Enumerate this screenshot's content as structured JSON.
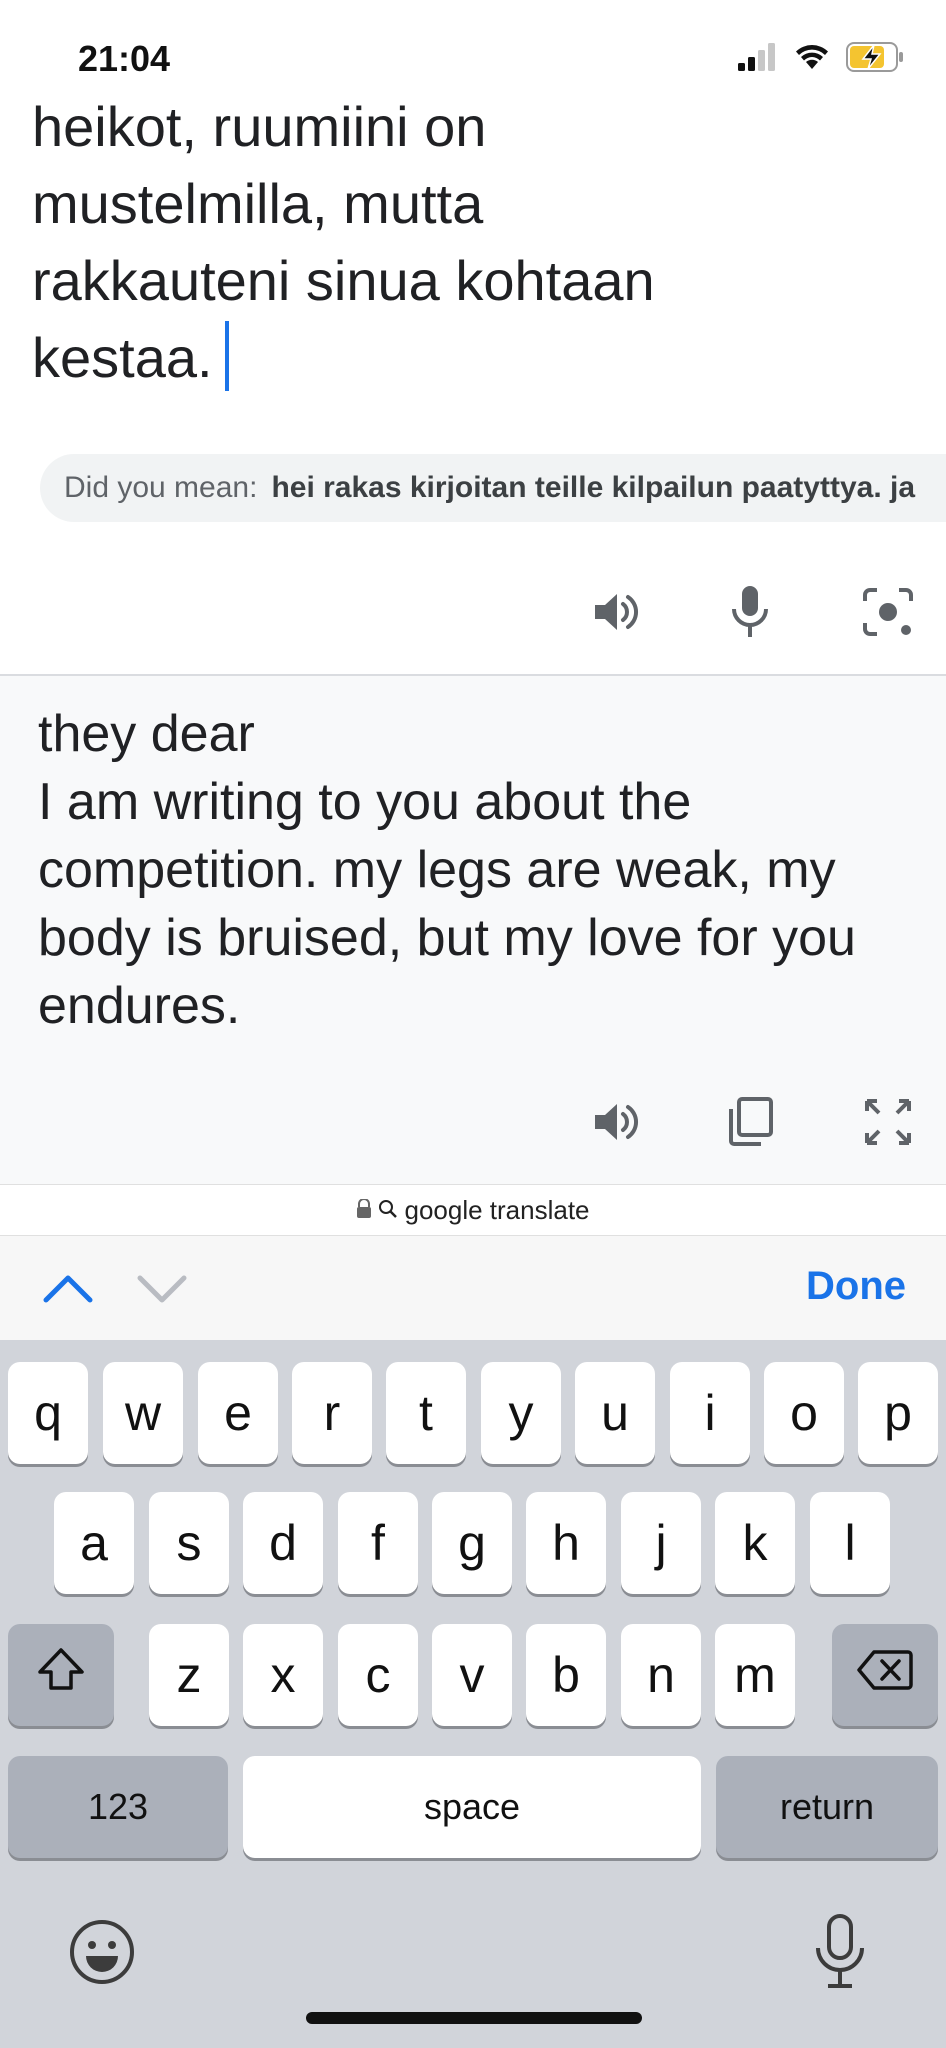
{
  "status_bar": {
    "time": "21:04",
    "signal_icon": "cellular-signal-icon",
    "wifi_icon": "wifi-icon",
    "battery_icon": "battery-charging-icon",
    "battery_color": "#f4c430"
  },
  "source": {
    "cut_line": "heikot, ruumiini on",
    "text": "heikot, ruumiini on\nmustelmilla, mutta\nrakkauteni sinua kohtaan\nkestaa."
  },
  "suggestion": {
    "label": "Did you mean:",
    "value": "hei rakas kirjoitan teille kilpailun paatyttya. ja"
  },
  "source_actions": [
    "speaker-icon",
    "microphone-icon",
    "camera-icon"
  ],
  "translation": {
    "text": "they dear\nI am writing to you about the competition. my legs are weak, my body is bruised, but my love for you endures."
  },
  "translation_actions": [
    "speaker-icon",
    "copy-icon",
    "fullscreen-icon"
  ],
  "address_bar": {
    "text": "google translate"
  },
  "accessory": {
    "done_label": "Done",
    "accent_color": "#1a73e8"
  },
  "keyboard": {
    "row1": [
      "q",
      "w",
      "e",
      "r",
      "t",
      "y",
      "u",
      "i",
      "o",
      "p"
    ],
    "row2": [
      "a",
      "s",
      "d",
      "f",
      "g",
      "h",
      "j",
      "k",
      "l"
    ],
    "row3": [
      "z",
      "x",
      "c",
      "v",
      "b",
      "n",
      "m"
    ],
    "numbers_label": "123",
    "space_label": "space",
    "return_label": "return"
  }
}
